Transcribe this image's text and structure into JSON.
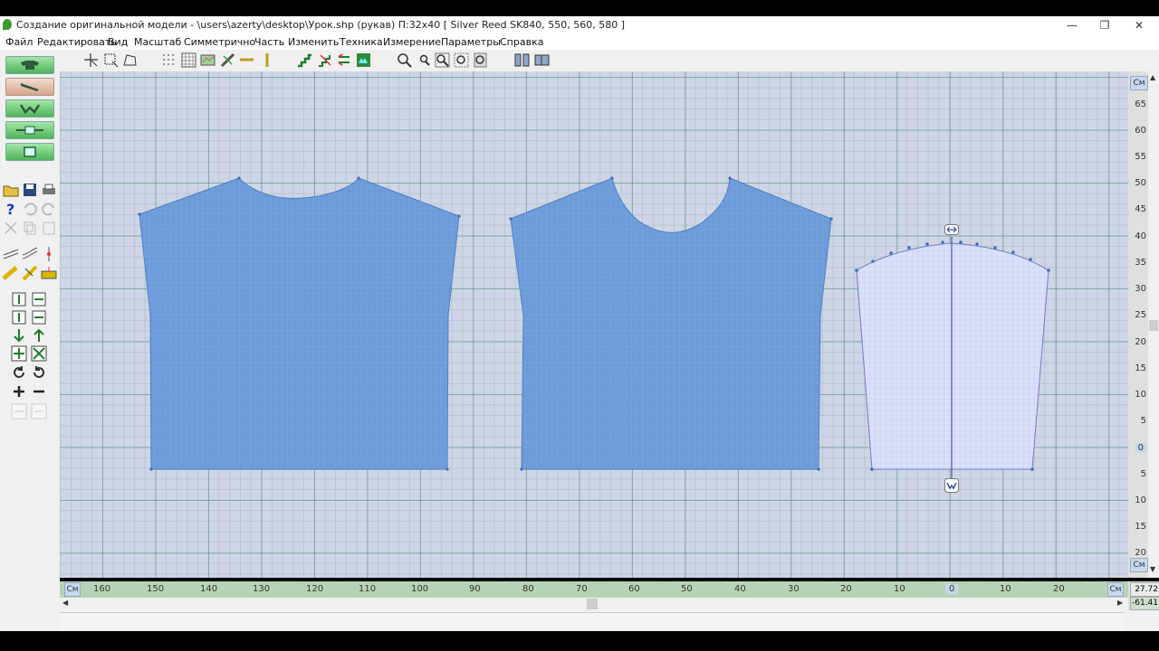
{
  "window": {
    "title": "Создание оригинальной модели - \\users\\azerty\\desktop\\Урок.shp (рукав)      П:32x40     [ Silver Reed SK840, 550, 560, 580 ]",
    "minimize": "—",
    "restore": "❐",
    "close": "✕"
  },
  "menu": [
    "Файл",
    "Редактировать",
    "Вид",
    "Масштаб",
    "Симметрично",
    "Часть",
    "Изменить",
    "Техника",
    "Измерение",
    "Параметры",
    "Справка"
  ],
  "toolbar": {
    "icons": [
      "select-arrow-icon",
      "select-box-icon",
      "lasso-icon",
      "dots-grid-icon",
      "grid-icon",
      "pattern-icon",
      "ruler-icon",
      "line-icon",
      "steps-icon",
      "curve-steps-icon",
      "arrows-icon",
      "heart-icon",
      "zoom-in-icon",
      "zoom-out-icon",
      "zoom-fit-icon",
      "zoom-area-icon",
      "zoom-page-icon",
      "compare-icon",
      "mirror-icon"
    ]
  },
  "left_panel": {
    "garment_buttons": [
      "sweater-icon",
      "sleeve-icon",
      "collar-icon",
      "belt-icon",
      "pocket-icon"
    ],
    "selected": "sleeve-icon"
  },
  "ruler": {
    "unit": "См",
    "vertical_ticks": [
      "65",
      "60",
      "55",
      "50",
      "45",
      "40",
      "35",
      "30",
      "25",
      "20",
      "15",
      "10",
      "5",
      "0",
      "5",
      "10",
      "15",
      "20"
    ],
    "horizontal_ticks": [
      "160",
      "150",
      "140",
      "130",
      "120",
      "110",
      "100",
      "90",
      "80",
      "70",
      "60",
      "50",
      "40",
      "30",
      "20",
      "10",
      "0",
      "10",
      "20"
    ]
  },
  "coords": {
    "x": "27.72",
    "y": "-61.41"
  },
  "colors": {
    "piece_fill": "#6b9bd8",
    "sleeve_fill": "#dbe0fa",
    "canvas_bg": "#cfd5e6",
    "accent_green": "#53b85e"
  }
}
